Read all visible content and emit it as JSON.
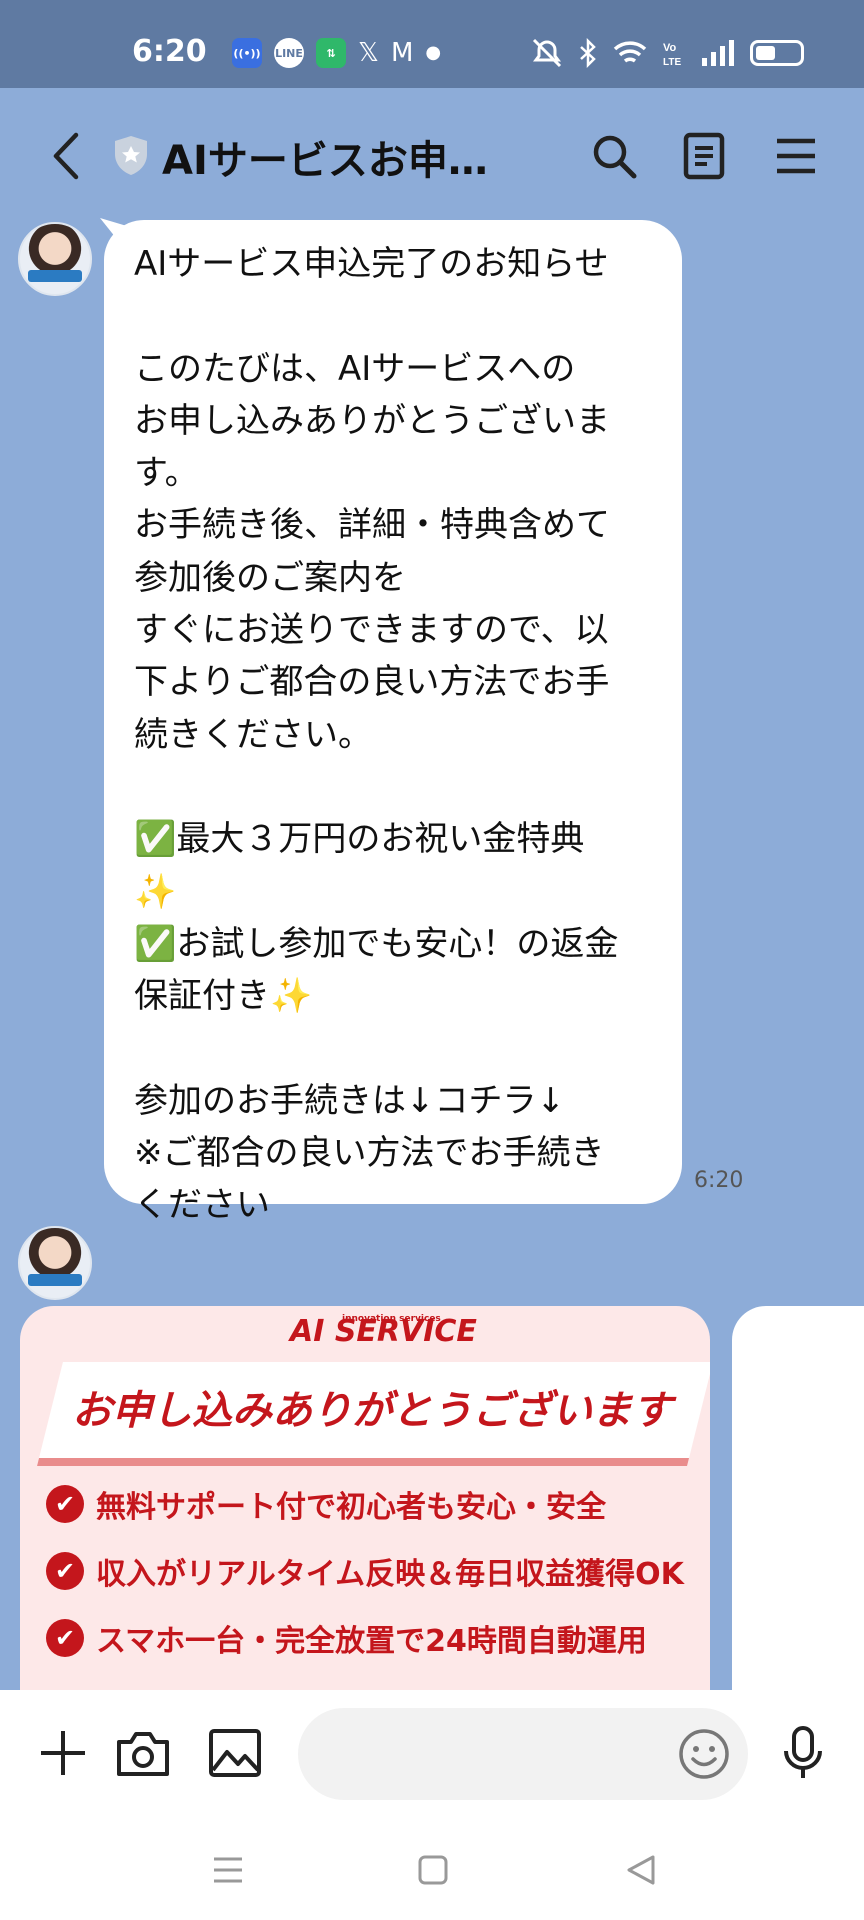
{
  "status_bar": {
    "time": "6:20",
    "notification_icons": [
      "broadcast-icon",
      "line-icon",
      "sync-icon",
      "x-icon",
      "gmail-icon",
      "dot-icon"
    ],
    "system_icons": [
      "mute-vibrate-icon",
      "bluetooth-icon",
      "wifi-icon",
      "volte-icon",
      "signal-icon",
      "battery-icon"
    ],
    "battery_level": 0.45
  },
  "header": {
    "title": "AIサービスお申込...",
    "buttons": [
      "search-icon",
      "note-icon",
      "menu-icon"
    ]
  },
  "message": {
    "lines": [
      "AIサービス申込完了のお知らせ",
      "",
      "このたびは、AIサービスへの",
      "お申し込みありがとうございま",
      "す。",
      "お手続き後、詳細・特典含めて",
      "参加後のご案内を",
      "すぐにお送りできますので、以",
      "下よりご都合の良い方法でお手",
      "続きください。",
      "",
      "✅最大３万円のお祝い金特典",
      "✨",
      "✅お試し参加でも安心！の返金",
      "保証付き✨",
      "",
      "参加のお手続きは↓コチラ↓",
      "※ご都合の良い方法でお手続き",
      "ください"
    ],
    "time": "6:20"
  },
  "card": {
    "logo": "AI SERVICE",
    "logo_sub": "innovation services",
    "banner": "お申し込みありがとうございます",
    "features": [
      "無料サポート付で初心者も安心・安全",
      "収入がリアルタイム反映＆毎日収益獲得OK",
      "スマホ一台・完全放置で24時間自動運用"
    ]
  },
  "input_bar": {
    "placeholder": "",
    "buttons": [
      "plus-icon",
      "camera-icon",
      "image-icon",
      "emoji-icon",
      "microphone-icon"
    ]
  },
  "nav_bar": {
    "buttons": [
      "recent-apps-icon",
      "home-icon",
      "back-icon"
    ]
  },
  "colors": {
    "chat_background": "#8dacd8",
    "status_bar": "#5f7aa2",
    "brand_red": "#c4161c",
    "card_pink": "#fde8e8"
  }
}
